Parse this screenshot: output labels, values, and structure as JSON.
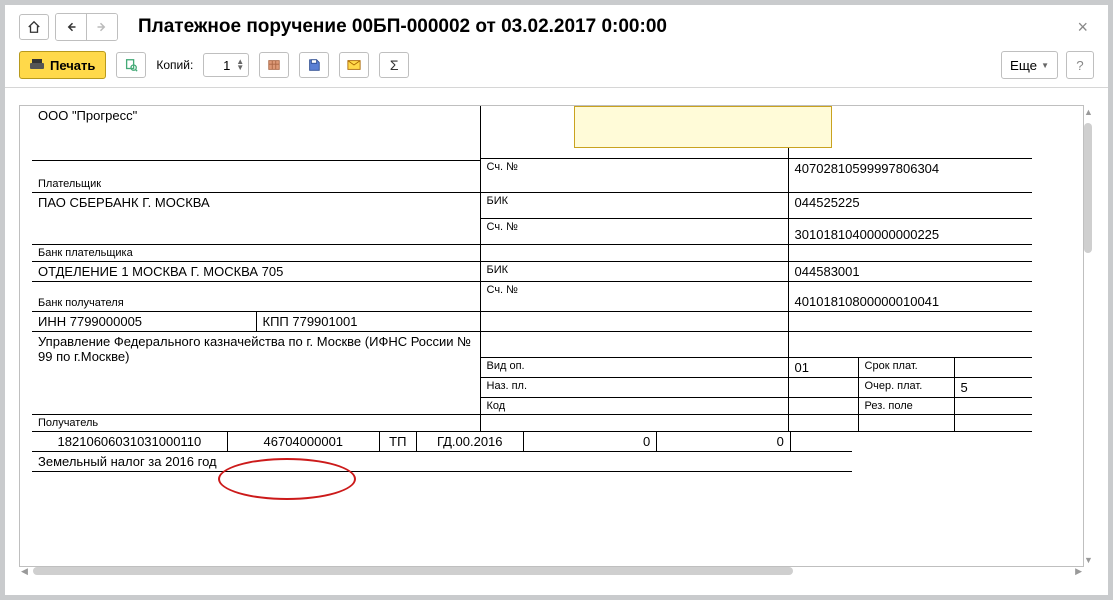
{
  "window": {
    "title": "Платежное поручение 00БП-000002 от 03.02.2017 0:00:00"
  },
  "toolbar": {
    "print_label": "Печать",
    "copies_label": "Копий:",
    "copies_value": "1",
    "more_label": "Еще"
  },
  "doc": {
    "payer_name": "ООО \"Прогресс\"",
    "payer_label": "Плательщик",
    "acc_label": "Сч. №",
    "payer_acc": "40702810599997806304",
    "payer_bank": "ПАО СБЕРБАНК Г. МОСКВА",
    "payer_bank_label": "Банк плательщика",
    "bik_label": "БИК",
    "payer_bik": "044525225",
    "payer_bank_acc": "30101810400000000225",
    "payee_bank": "ОТДЕЛЕНИЕ 1 МОСКВА Г. МОСКВА 705",
    "payee_bank_label": "Банк получателя",
    "payee_bik": "044583001",
    "inn_label": "ИНН 7799000005",
    "kpp_label": "КПП 779901001",
    "payee_acc": "40101810800000010041",
    "payee_name": "Управление Федерального казначейства по г. Москве (ИФНС России № 99 по г.Москве)",
    "payee_label": "Получатель",
    "vid_op_label": "Вид оп.",
    "vid_op": "01",
    "srok_label": "Срок плат.",
    "naz_label": "Наз. пл.",
    "ocher_label": "Очер. плат.",
    "ocher": "5",
    "kod_label": "Код",
    "rez_label": "Рез. поле",
    "row_codes": {
      "c1": "18210606031031000110",
      "c2": "46704000001",
      "c3": "ТП",
      "c4": "ГД.00.2016",
      "c5": "0",
      "c6": "0"
    },
    "purpose": "Земельный налог за 2016 год"
  }
}
